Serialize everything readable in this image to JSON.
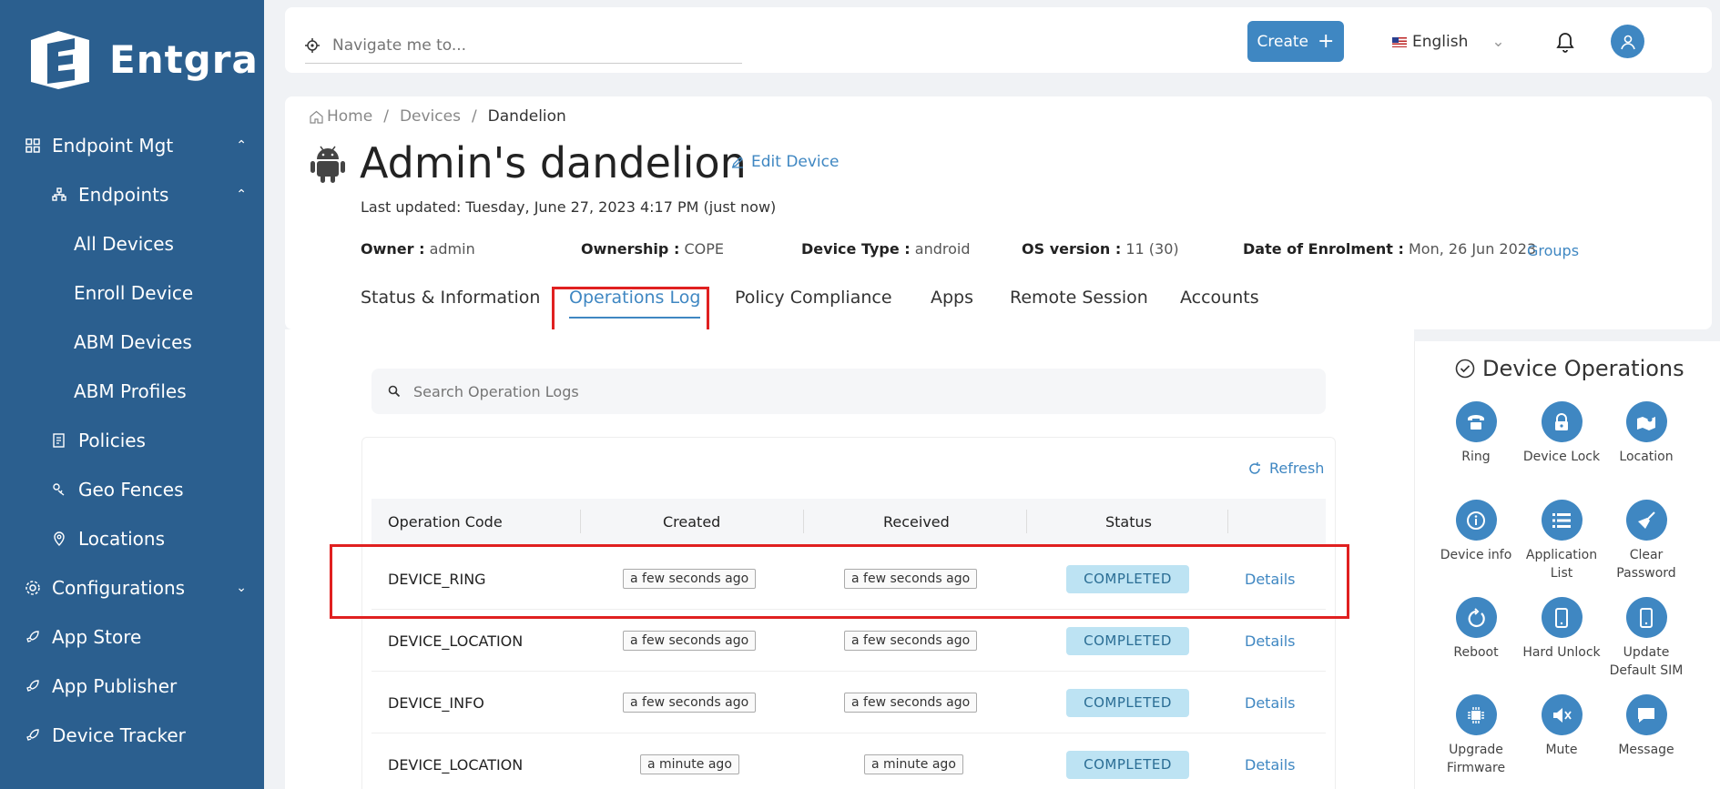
{
  "brand": {
    "name": "Entgra"
  },
  "sidebar": {
    "items": [
      {
        "label": "Endpoint Mgt",
        "level": 1,
        "icon": "grid-icon",
        "chevron": "up"
      },
      {
        "label": "Endpoints",
        "level": 2,
        "icon": "endpoints-icon",
        "chevron": "up"
      },
      {
        "label": "All Devices",
        "level": 3
      },
      {
        "label": "Enroll Device",
        "level": 3
      },
      {
        "label": "ABM Devices",
        "level": 3
      },
      {
        "label": "ABM Profiles",
        "level": 3
      },
      {
        "label": "Policies",
        "level": 2,
        "icon": "policy-icon"
      },
      {
        "label": "Geo Fences",
        "level": 2,
        "icon": "geofence-icon"
      },
      {
        "label": "Locations",
        "level": 2,
        "icon": "location-pin-icon"
      },
      {
        "label": "Configurations",
        "level": 1,
        "icon": "gear-icon",
        "chevron": "down"
      },
      {
        "label": "App Store",
        "level": 1,
        "icon": "rocket-icon"
      },
      {
        "label": "App Publisher",
        "level": 1,
        "icon": "rocket-icon"
      },
      {
        "label": "Device Tracker",
        "level": 1,
        "icon": "rocket-icon"
      }
    ]
  },
  "topbar": {
    "search_placeholder": "Navigate me to...",
    "create_label": "Create",
    "language": "English"
  },
  "header": {
    "breadcrumb": [
      "Home",
      "Devices",
      "Dandelion"
    ],
    "title": "Admin's dandelion",
    "edit_label": "Edit Device",
    "last_updated": "Last updated: Tuesday, June 27, 2023 4:17 PM (just now)",
    "meta": {
      "owner_label": "Owner :",
      "owner": "admin",
      "ownership_label": "Ownership :",
      "ownership": "COPE",
      "device_type_label": "Device Type :",
      "device_type": "android",
      "os_label": "OS version :",
      "os": "11 (30)",
      "enrolment_label": "Date of Enrolment :",
      "enrolment": "Mon, 26 Jun 2023"
    },
    "groups_label": "Groups",
    "tabs": [
      "Status & Information",
      "Operations Log",
      "Policy Compliance",
      "Apps",
      "Remote Session",
      "Accounts"
    ],
    "active_tab": "Operations Log"
  },
  "operations_log": {
    "search_placeholder": "Search Operation Logs",
    "refresh_label": "Refresh",
    "columns": [
      "Operation Code",
      "Created",
      "Received",
      "Status"
    ],
    "rows": [
      {
        "code": "DEVICE_RING",
        "created": "a few seconds ago",
        "received": "a few seconds ago",
        "status": "COMPLETED",
        "action": "Details"
      },
      {
        "code": "DEVICE_LOCATION",
        "created": "a few seconds ago",
        "received": "a few seconds ago",
        "status": "COMPLETED",
        "action": "Details"
      },
      {
        "code": "DEVICE_INFO",
        "created": "a few seconds ago",
        "received": "a few seconds ago",
        "status": "COMPLETED",
        "action": "Details"
      },
      {
        "code": "DEVICE_LOCATION",
        "created": "a minute ago",
        "received": "a minute ago",
        "status": "COMPLETED",
        "action": "Details"
      }
    ]
  },
  "device_operations": {
    "title": "Device Operations",
    "ops": [
      {
        "label": "Ring",
        "icon": "phone-icon"
      },
      {
        "label": "Device Lock",
        "icon": "lock-icon"
      },
      {
        "label": "Location",
        "icon": "map-icon"
      },
      {
        "label": "Device info",
        "icon": "info-icon"
      },
      {
        "label": "Application List",
        "icon": "list-icon"
      },
      {
        "label": "Clear Password",
        "icon": "broom-icon"
      },
      {
        "label": "Reboot",
        "icon": "reboot-icon"
      },
      {
        "label": "Hard Unlock",
        "icon": "mobile-icon"
      },
      {
        "label": "Update Default SIM",
        "icon": "mobile-icon"
      },
      {
        "label": "Upgrade Firmware",
        "icon": "chip-icon"
      },
      {
        "label": "Mute",
        "icon": "mute-icon"
      },
      {
        "label": "Message",
        "icon": "message-icon"
      }
    ]
  },
  "colors": {
    "sidebar": "#2b5f8f",
    "accent": "#3f87c2",
    "highlight": "#e02020",
    "status_bg": "#bde3f3"
  }
}
